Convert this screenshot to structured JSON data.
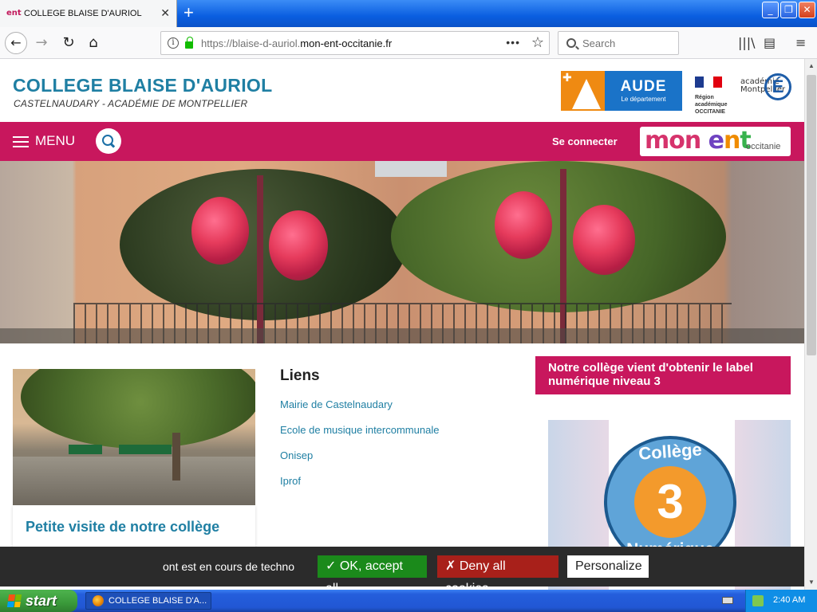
{
  "browser": {
    "tab_title": "COLLEGE BLAISE D'AURIOL",
    "favicon_text": "ent",
    "url_domain_prefix": "https://blaise-d-auriol.",
    "url_domain_main": "mon-ent-occitanie.fr",
    "search_placeholder": "Search"
  },
  "site": {
    "title": "COLLEGE BLAISE D'AURIOL",
    "subtitle": "CASTELNAUDARY - ACADÉMIE DE MONTPELLIER",
    "aude_name": "AUDE",
    "aude_dep": "Le département",
    "region_line1": "Région académique",
    "region_line2": "OCCITANIE",
    "acad_line1": "académie",
    "acad_line2": "Montpellier",
    "acad_letter": "É"
  },
  "menu": {
    "label": "MENU",
    "connect": "Se connecter",
    "monent_m1": "mon",
    "monent_m2": " e",
    "monent_m3": "n",
    "monent_m4": "t",
    "monent_region": "occitanie"
  },
  "content": {
    "card_title": "Petite visite de notre collège",
    "links_title": "Liens",
    "links": [
      "Mairie de Castelnaudary",
      "Ecole de musique intercommunale",
      "Onisep",
      "Iprof"
    ],
    "label_text": "Notre collège vient d'obtenir le label numérique niveau 3",
    "badge_top": "Collège",
    "badge_num": "3",
    "badge_bot": "Numérique"
  },
  "cookies": {
    "text": "ont est en cours de techno",
    "ok": "✓ OK, accept all",
    "deny": "✗ Deny all cookies",
    "personalize": "Personalize"
  },
  "taskbar": {
    "start": "start",
    "item": "COLLEGE BLAISE D'A...",
    "clock": "2:40 AM"
  },
  "colors": {
    "brand_pink": "#c8175d",
    "brand_blue": "#1f7fa3"
  }
}
